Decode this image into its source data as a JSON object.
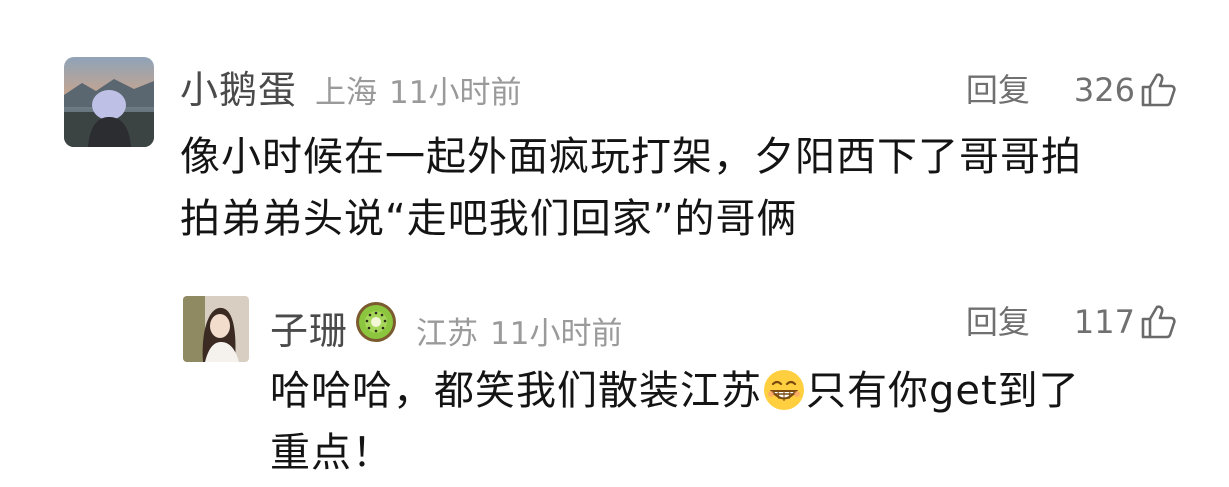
{
  "comments": [
    {
      "username": "小鹅蛋",
      "location": "上海",
      "time": "11小时前",
      "reply_label": "回复",
      "likes": "326",
      "content_lines": [
        "像小时候在一起外面疯玩打架，夕阳西下了哥哥拍",
        "拍弟弟头说“走吧我们回家”的哥俩"
      ]
    },
    {
      "username": "子珊",
      "location": "江苏",
      "time": "11小时前",
      "reply_label": "回复",
      "likes": "117",
      "content_part1": "哈哈哈，都笑我们散装江苏",
      "content_part2": "只有你get到了",
      "content_line2": "重点！",
      "badge_icon": "kiwi-icon",
      "inline_emoji": "grinning-face-emoji"
    }
  ],
  "colors": {
    "username": "#4a4a4a",
    "meta": "#9a9a9a",
    "actions": "#707070",
    "content": "#141414"
  }
}
